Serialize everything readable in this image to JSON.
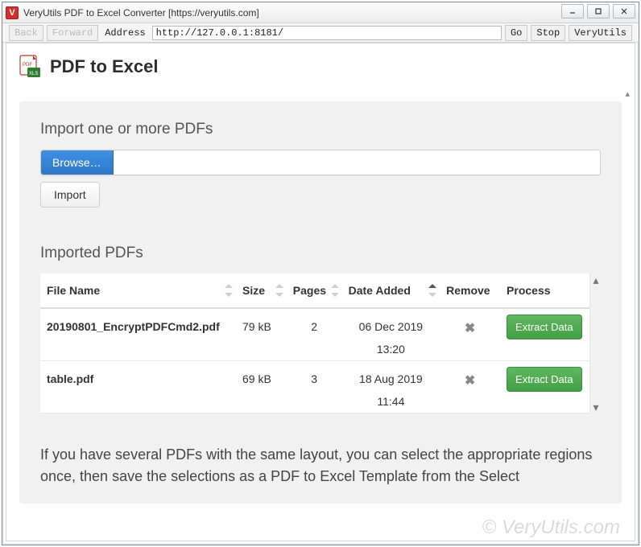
{
  "window": {
    "title": "VeryUtils PDF to Excel Converter [https://veryutils.com]",
    "appicon_letter": "V"
  },
  "toolbar": {
    "back": "Back",
    "forward": "Forward",
    "address_label": "Address",
    "address_value": "http://127.0.0.1:8181/",
    "go": "Go",
    "stop": "Stop",
    "brand": "VeryUtils"
  },
  "page": {
    "title": "PDF to Excel",
    "import_section_title": "Import one or more PDFs",
    "browse_label": "Browse…",
    "file_input_value": "",
    "import_button": "Import",
    "imported_section_title": "Imported PDFs",
    "columns": {
      "file_name": "File Name",
      "size": "Size",
      "pages": "Pages",
      "date_added": "Date Added",
      "remove": "Remove",
      "process": "Process"
    },
    "rows": [
      {
        "file_name": "20190801_EncryptPDFCmd2.pdf",
        "size": "79 kB",
        "pages": "2",
        "date": "06 Dec 2019",
        "time": "13:20",
        "process": "Extract Data"
      },
      {
        "file_name": "table.pdf",
        "size": "69 kB",
        "pages": "3",
        "date": "18 Aug 2019",
        "time": "11:44",
        "process": "Extract Data"
      }
    ],
    "footer_text": "If you have several PDFs with the same layout, you can select the appropriate regions once, then save the selections as a PDF to Excel Template from the Select"
  },
  "watermark": "© VeryUtils.com"
}
